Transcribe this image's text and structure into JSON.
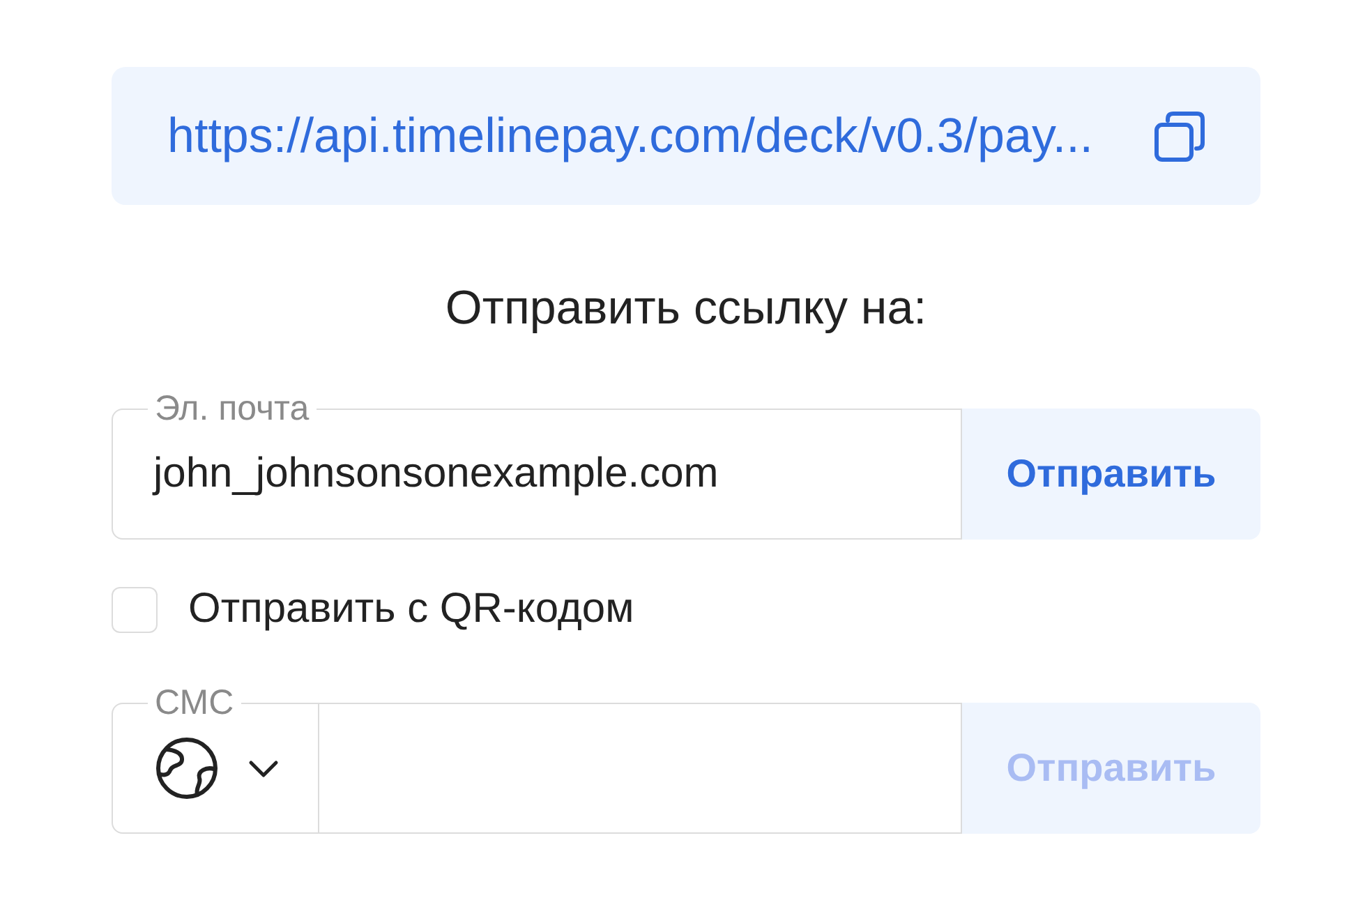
{
  "link": {
    "url": "https://api.timelinepay.com/deck/v0.3/pay..."
  },
  "heading": "Отправить ссылку на:",
  "email": {
    "label": "Эл. почта",
    "value": "john_johnsonsonexample.com",
    "button": {
      "label": "Отправить",
      "disabled": false
    }
  },
  "qr_option": {
    "label": "Отправить с QR-кодом",
    "checked": false
  },
  "sms": {
    "label": "СМС",
    "button": {
      "label": "Отправить",
      "disabled": true
    }
  }
}
